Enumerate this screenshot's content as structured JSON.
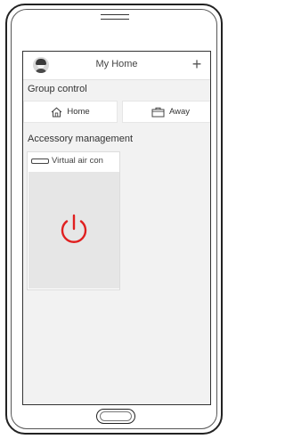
{
  "header": {
    "title": "My Home",
    "add_label": "+"
  },
  "group_control": {
    "label": "Group control",
    "buttons": [
      {
        "label": "Home",
        "icon": "house-icon"
      },
      {
        "label": "Away",
        "icon": "briefcase-icon"
      }
    ]
  },
  "accessory_management": {
    "label": "Accessory management",
    "items": [
      {
        "name": "Virtual air con",
        "icon": "air-conditioner-icon",
        "power_icon": "power-icon",
        "power_color": "#e02020"
      }
    ]
  }
}
